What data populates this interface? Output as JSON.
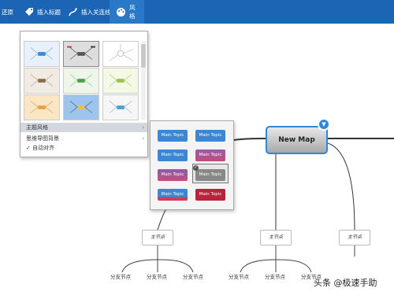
{
  "toolbar": {
    "undo_label": "还原",
    "insert_title_label": "插入标题",
    "insert_link_label": "插入关连线",
    "style_label": "风格"
  },
  "style_menu": {
    "items": [
      {
        "label": "主题风格",
        "arrow": "›"
      },
      {
        "label": "思维导图背景",
        "arrow": "›"
      },
      {
        "label": "✓ 自动对齐",
        "arrow": ""
      }
    ]
  },
  "theme_menu": {
    "topics": [
      "Main Topic",
      "Main Topic",
      "Main Topic",
      "Main Topic",
      "Main Topic",
      "Main Topic",
      "Main Topic",
      "Main Topic"
    ]
  },
  "central_node": {
    "label": "New Map",
    "badge": "▼"
  },
  "main_nodes": [
    "主节点",
    "主节点",
    "主节点"
  ],
  "leaves": [
    "分支节点",
    "分支节点",
    "分支节点",
    "分支节点",
    "分支节点",
    "分支节点"
  ],
  "watermark": "头条 @极速手助",
  "colors": {
    "toolbar": "#1c65b5",
    "accent": "#2b8ad8",
    "annotation_arrow": "#e0303a"
  }
}
